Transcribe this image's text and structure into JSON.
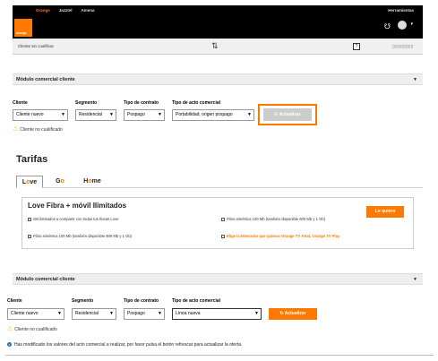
{
  "topbar": {
    "nav": [
      "Orange",
      "Jazztel",
      "Amena"
    ],
    "herramientas": "Herramientas",
    "logo_text": "orange"
  },
  "customer_bar": {
    "text": "Cliente sin cualificar",
    "help": "?",
    "dots": "▯▯▯▯▯▯▯▯"
  },
  "module1": {
    "title": "Módulo comercial cliente",
    "labels": {
      "cliente": "Cliente",
      "segmento": "Segmento",
      "contrato": "Tipo de contrato",
      "acto": "Tipo de acto comercial"
    },
    "values": {
      "cliente": "Cliente nuevo",
      "segmento": "Residencial",
      "contrato": "Pospago",
      "acto": "Portabilidad, origen pospago"
    },
    "update_button": "Actualizar",
    "warning": "Cliente no cualificado"
  },
  "tarifas": {
    "title": "Tarifas",
    "tabs": [
      {
        "pre": "L",
        "accent": "o",
        "post": "ve"
      },
      {
        "pre": "G",
        "accent": "o",
        "post": ""
      },
      {
        "pre": "H",
        "accent": "o",
        "post": "me"
      }
    ],
    "offer": {
      "title": "Love Fibra + móvil Ilimitados",
      "features_left": [
        "GB ilimitados a compartir con todas tus líneas Love",
        "Fibra simétrica 100 Mb (también disponible 600 Mb y 1 Gb)"
      ],
      "features_right": [
        "Fibra simétrica 100 Mb (también disponible 600 Mb y 1 Gb)",
        "Elige la televisión que quieras Orange TV Total, Orange TV Play"
      ],
      "cta": "Lo quiero"
    }
  },
  "module2": {
    "title": "Módulo comercial cliente",
    "labels": {
      "cliente": "Cliente",
      "segmento": "Segmento",
      "contrato": "Tipo de contrato",
      "acto": "Tipo de acto comercial"
    },
    "values": {
      "cliente": "Cliente nuevo",
      "segmento": "Residencial",
      "contrato": "Pospago",
      "acto": "Línea nueva"
    },
    "update_button": "Actualizar",
    "warning": "Cliente no cualificado"
  },
  "info_message": "Has modificado los valores del acto comercial a realizar, por favor pulsa el botón refrescar para actualizar la oferta.",
  "colors": {
    "brand": "#ff7900",
    "topbar": "#000000",
    "info": "#1f6fb2"
  }
}
